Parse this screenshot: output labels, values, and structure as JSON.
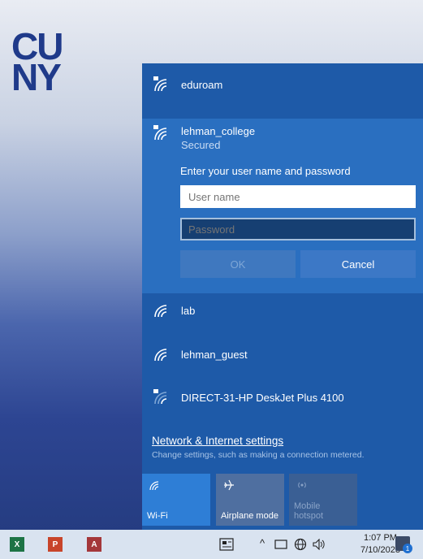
{
  "logo": {
    "line1": "CU",
    "line2": "NY"
  },
  "networks": {
    "eduroam": {
      "ssid": "eduroam"
    },
    "selected": {
      "ssid": "lehman_college",
      "status": "Secured",
      "prompt": "Enter your user name and password"
    },
    "lab": {
      "ssid": "lab"
    },
    "guest": {
      "ssid": "lehman_guest"
    },
    "direct": {
      "ssid": "DIRECT-31-HP DeskJet Plus 4100"
    }
  },
  "login": {
    "username_placeholder": "User name",
    "password_placeholder": "Password",
    "ok_label": "OK",
    "cancel_label": "Cancel"
  },
  "settings": {
    "link": "Network & Internet settings",
    "description": "Change settings, such as making a connection metered."
  },
  "quick_actions": {
    "wifi_label": "Wi-Fi",
    "airplane_label": "Airplane mode",
    "hotspot_label_1": "Mobile",
    "hotspot_label_2": "hotspot"
  },
  "taskbar": {
    "apps": {
      "excel": "X",
      "powerpoint": "P",
      "access": "A"
    },
    "time": "1:07 PM",
    "date": "7/10/2023",
    "notification_count": "1",
    "chevron": "^"
  },
  "colors": {
    "flyout_bg": "#1e5aa8",
    "selected_bg": "#2a6fc0",
    "excel": "#1d7345",
    "powerpoint": "#c8442a",
    "access": "#a4373a"
  }
}
